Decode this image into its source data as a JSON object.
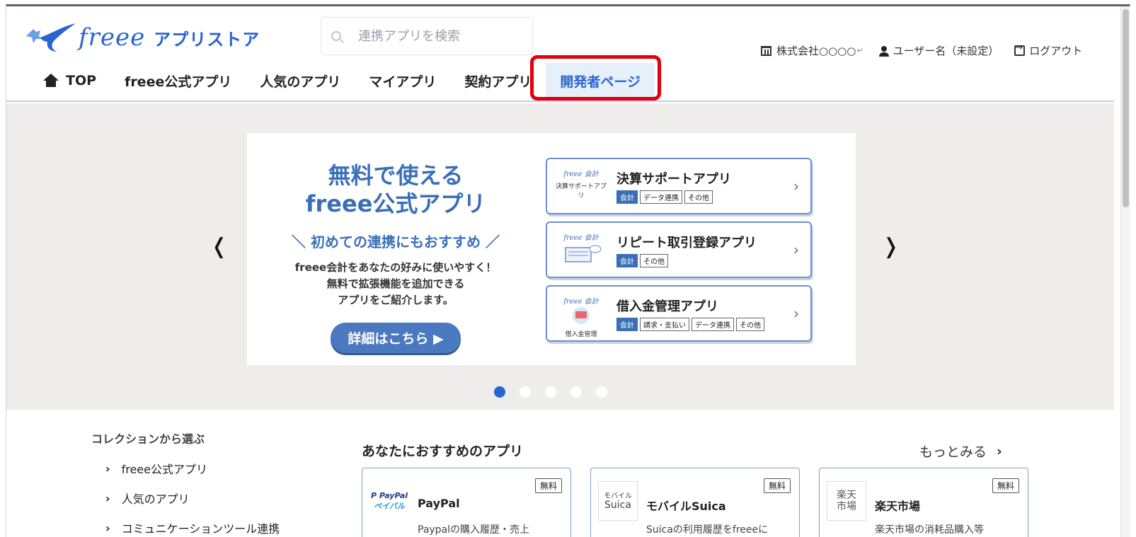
{
  "header": {
    "logo_word": "freee",
    "logo_app": "アプリストア",
    "search_placeholder": "連携アプリを検索",
    "company": "株式会社○○○○",
    "enter_mark": "↵",
    "user": "ユーザー名（未設定）",
    "logout": "ログアウト"
  },
  "nav": {
    "items": [
      {
        "label": "TOP"
      },
      {
        "label": "freee公式アプリ"
      },
      {
        "label": "人気のアプリ"
      },
      {
        "label": "マイアプリ"
      },
      {
        "label": "契約アプリ"
      },
      {
        "label": "開発者ページ"
      }
    ],
    "active_index": 5
  },
  "carousel": {
    "prev": "❬",
    "next": "❭",
    "promo_title_1": "無料で使える",
    "promo_title_2": "freee公式アプリ",
    "promo_sub": "＼ 初めての連携にもおすすめ ／",
    "promo_desc_1": "freee会計をあなたの好みに使いやすく！",
    "promo_desc_2": "無料で拡張機能を追加できる",
    "promo_desc_3": "アプリをご紹介します。",
    "promo_button": "詳細はこちら ▶",
    "cards": [
      {
        "title": "決算サポートアプリ",
        "thumb_logo": "freee 会計",
        "thumb_label": "決算サポートアプリ",
        "tags": [
          "会計",
          "データ連携",
          "その他"
        ]
      },
      {
        "title": "リピート取引登録アプリ",
        "thumb_logo": "freee 会計",
        "thumb_label": "",
        "tags": [
          "会計",
          "その他"
        ]
      },
      {
        "title": "借入金管理アプリ",
        "thumb_logo": "freee 会計",
        "thumb_label": "借入金管理",
        "tags": [
          "会計",
          "請求・支払い",
          "データ連携",
          "その他"
        ]
      }
    ],
    "card_chevron": "›",
    "dot_count": 5,
    "active_dot": 0
  },
  "collections": {
    "title": "コレクションから選ぶ",
    "items": [
      "freee公式アプリ",
      "人気のアプリ",
      "コミュニケーションツール連携"
    ]
  },
  "recommend": {
    "title": "あなたにおすすめのアプリ",
    "more": "もっとみる",
    "apps": [
      {
        "name": "PayPal",
        "badge": "無料",
        "desc": "Paypalの購入履歴・売上",
        "logo_a": "P PayPal",
        "logo_b": "ペイパル"
      },
      {
        "name": "モバイルSuica",
        "badge": "無料",
        "desc": "Suicaの利用履歴をfreeeに",
        "logo_a": "モバイル",
        "logo_b": "Suica"
      },
      {
        "name": "楽天市場",
        "badge": "無料",
        "desc": "楽天市場の消耗品購入等",
        "logo_a": "楽天",
        "logo_b": "市場"
      }
    ]
  },
  "colors": {
    "brand": "#2864d2",
    "highlight": "#e3000b",
    "promo": "#3a6fb8",
    "carousel_bg": "#eeedeb"
  }
}
